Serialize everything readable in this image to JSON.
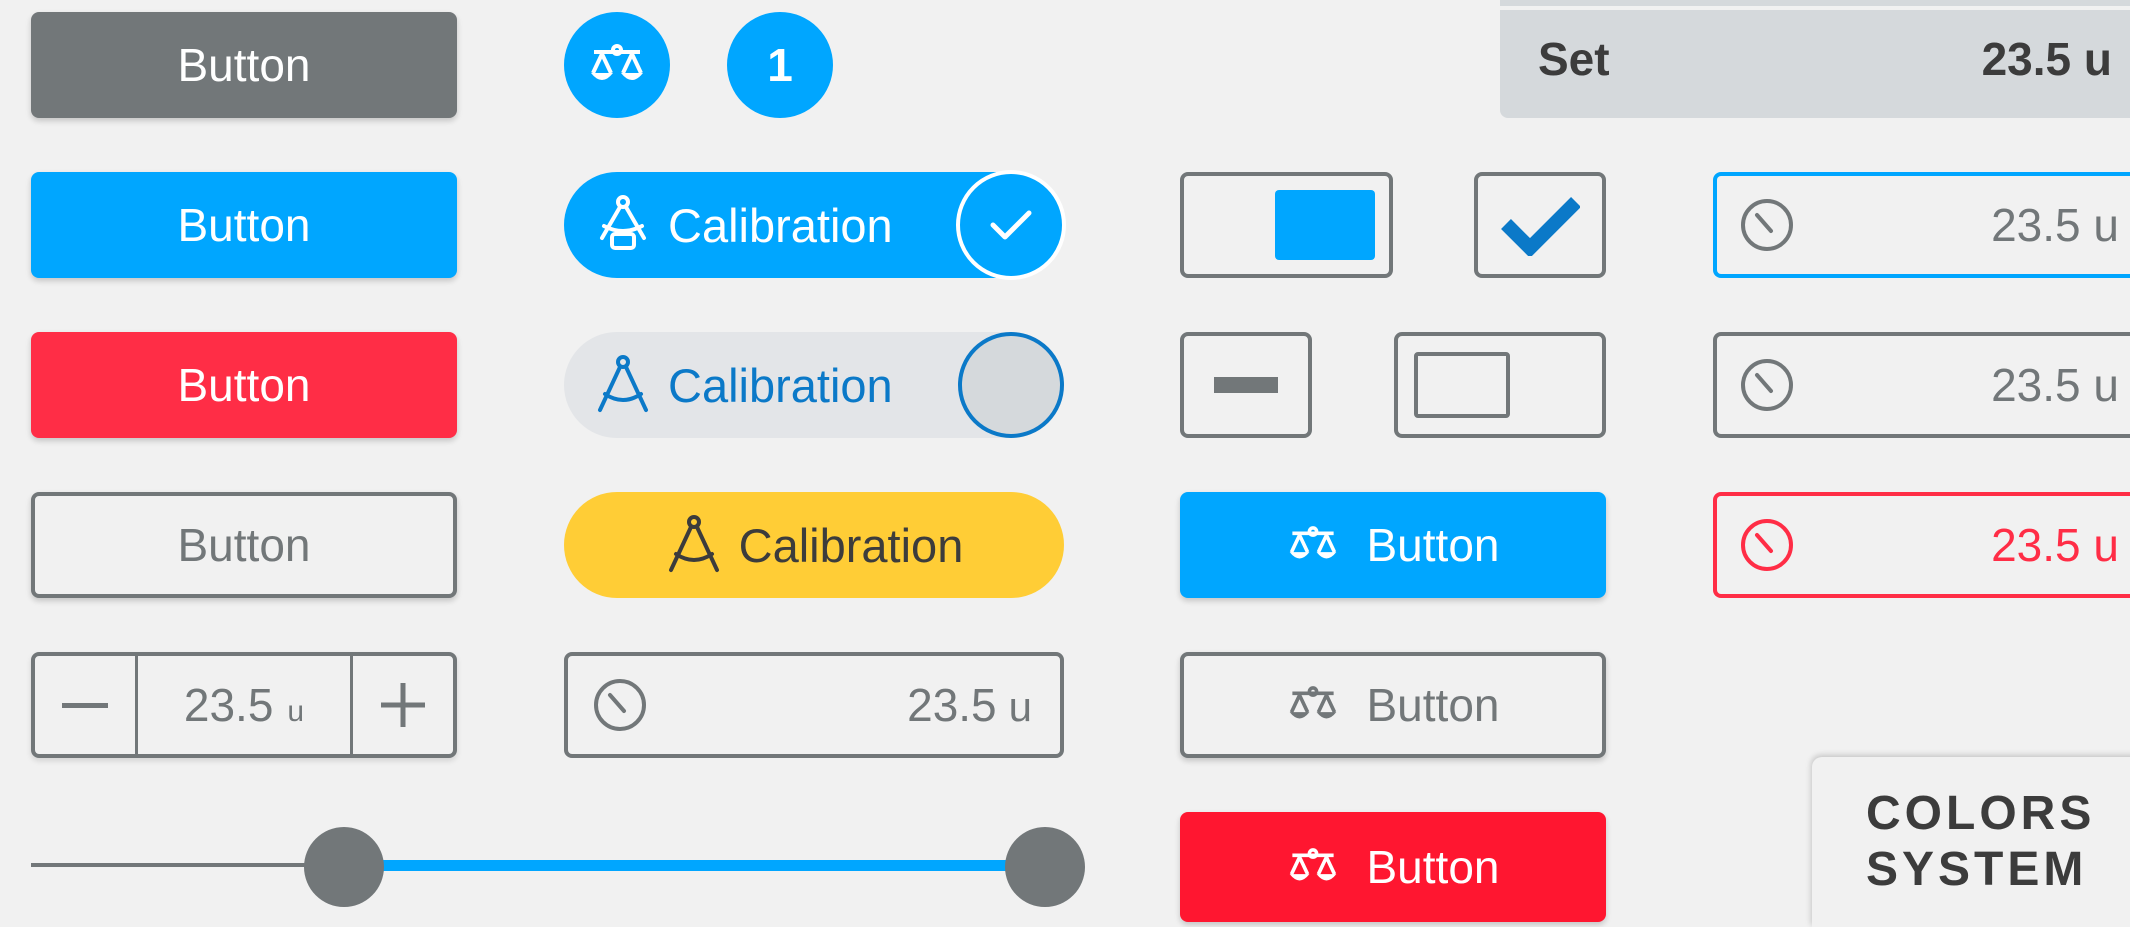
{
  "colors": {
    "gray": "#727779",
    "blue": "#00a6ff",
    "red": "#ff2d46",
    "yellow": "#ffcd36",
    "light": "#d5d9dc",
    "text_dark": "#3c3c3c",
    "blue_text": "#0b79c8"
  },
  "buttons": {
    "gray": "Button",
    "blue": "Button",
    "red": "Button",
    "outline": "Button",
    "icon_blue": "Button",
    "icon_outline": "Button",
    "icon_red": "Button"
  },
  "badge": {
    "count": "1"
  },
  "calibration": {
    "active": "Calibration",
    "inactive": "Calibration",
    "warning": "Calibration"
  },
  "stepper": {
    "value": "23.5",
    "unit": "u",
    "minus": "−",
    "plus": "+"
  },
  "timer_field": {
    "value": "23.5",
    "unit": "u"
  },
  "set_row": {
    "label": "Set",
    "value": "23.5 u"
  },
  "right_fields": [
    {
      "value": "23.5 u",
      "state": "focused"
    },
    {
      "value": "23.5 u",
      "state": "default"
    },
    {
      "value": "23.5 u",
      "state": "error"
    }
  ],
  "slider": {
    "low": 0.3,
    "high": 1.0
  },
  "checkbox": {
    "checked": true
  },
  "toggle_on": {
    "on": true
  },
  "toggle_off": {
    "on": false
  },
  "tag": {
    "line1": "COLORS",
    "line2": "SYSTEM"
  },
  "icons": {
    "scale": "scale-icon",
    "compass": "compass-icon",
    "check": "check-icon",
    "timer": "timer-icon",
    "minus": "minus-icon",
    "plus": "plus-icon"
  }
}
